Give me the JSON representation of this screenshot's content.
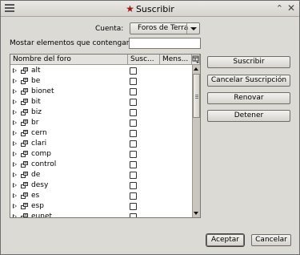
{
  "window": {
    "title": "Suscribir"
  },
  "account": {
    "label": "Cuenta:",
    "value": "Foros de Terra"
  },
  "filter": {
    "label": "Mostar elementos que contengan:",
    "value": ""
  },
  "table": {
    "columns": [
      "Nombre del foro",
      "Susc...",
      "Mens..."
    ],
    "rows": [
      {
        "name": "alt"
      },
      {
        "name": "be"
      },
      {
        "name": "bionet"
      },
      {
        "name": "bit"
      },
      {
        "name": "biz"
      },
      {
        "name": "br"
      },
      {
        "name": "cern"
      },
      {
        "name": "clari"
      },
      {
        "name": "comp"
      },
      {
        "name": "control"
      },
      {
        "name": "de"
      },
      {
        "name": "desy"
      },
      {
        "name": "es"
      },
      {
        "name": "esp"
      },
      {
        "name": "eunet"
      }
    ]
  },
  "actions": {
    "subscribe": "Suscribir",
    "cancel_subscription": "Cancelar Suscripción",
    "refresh": "Renovar",
    "stop": "Detener"
  },
  "footer": {
    "accept": "Aceptar",
    "cancel": "Cancelar"
  }
}
